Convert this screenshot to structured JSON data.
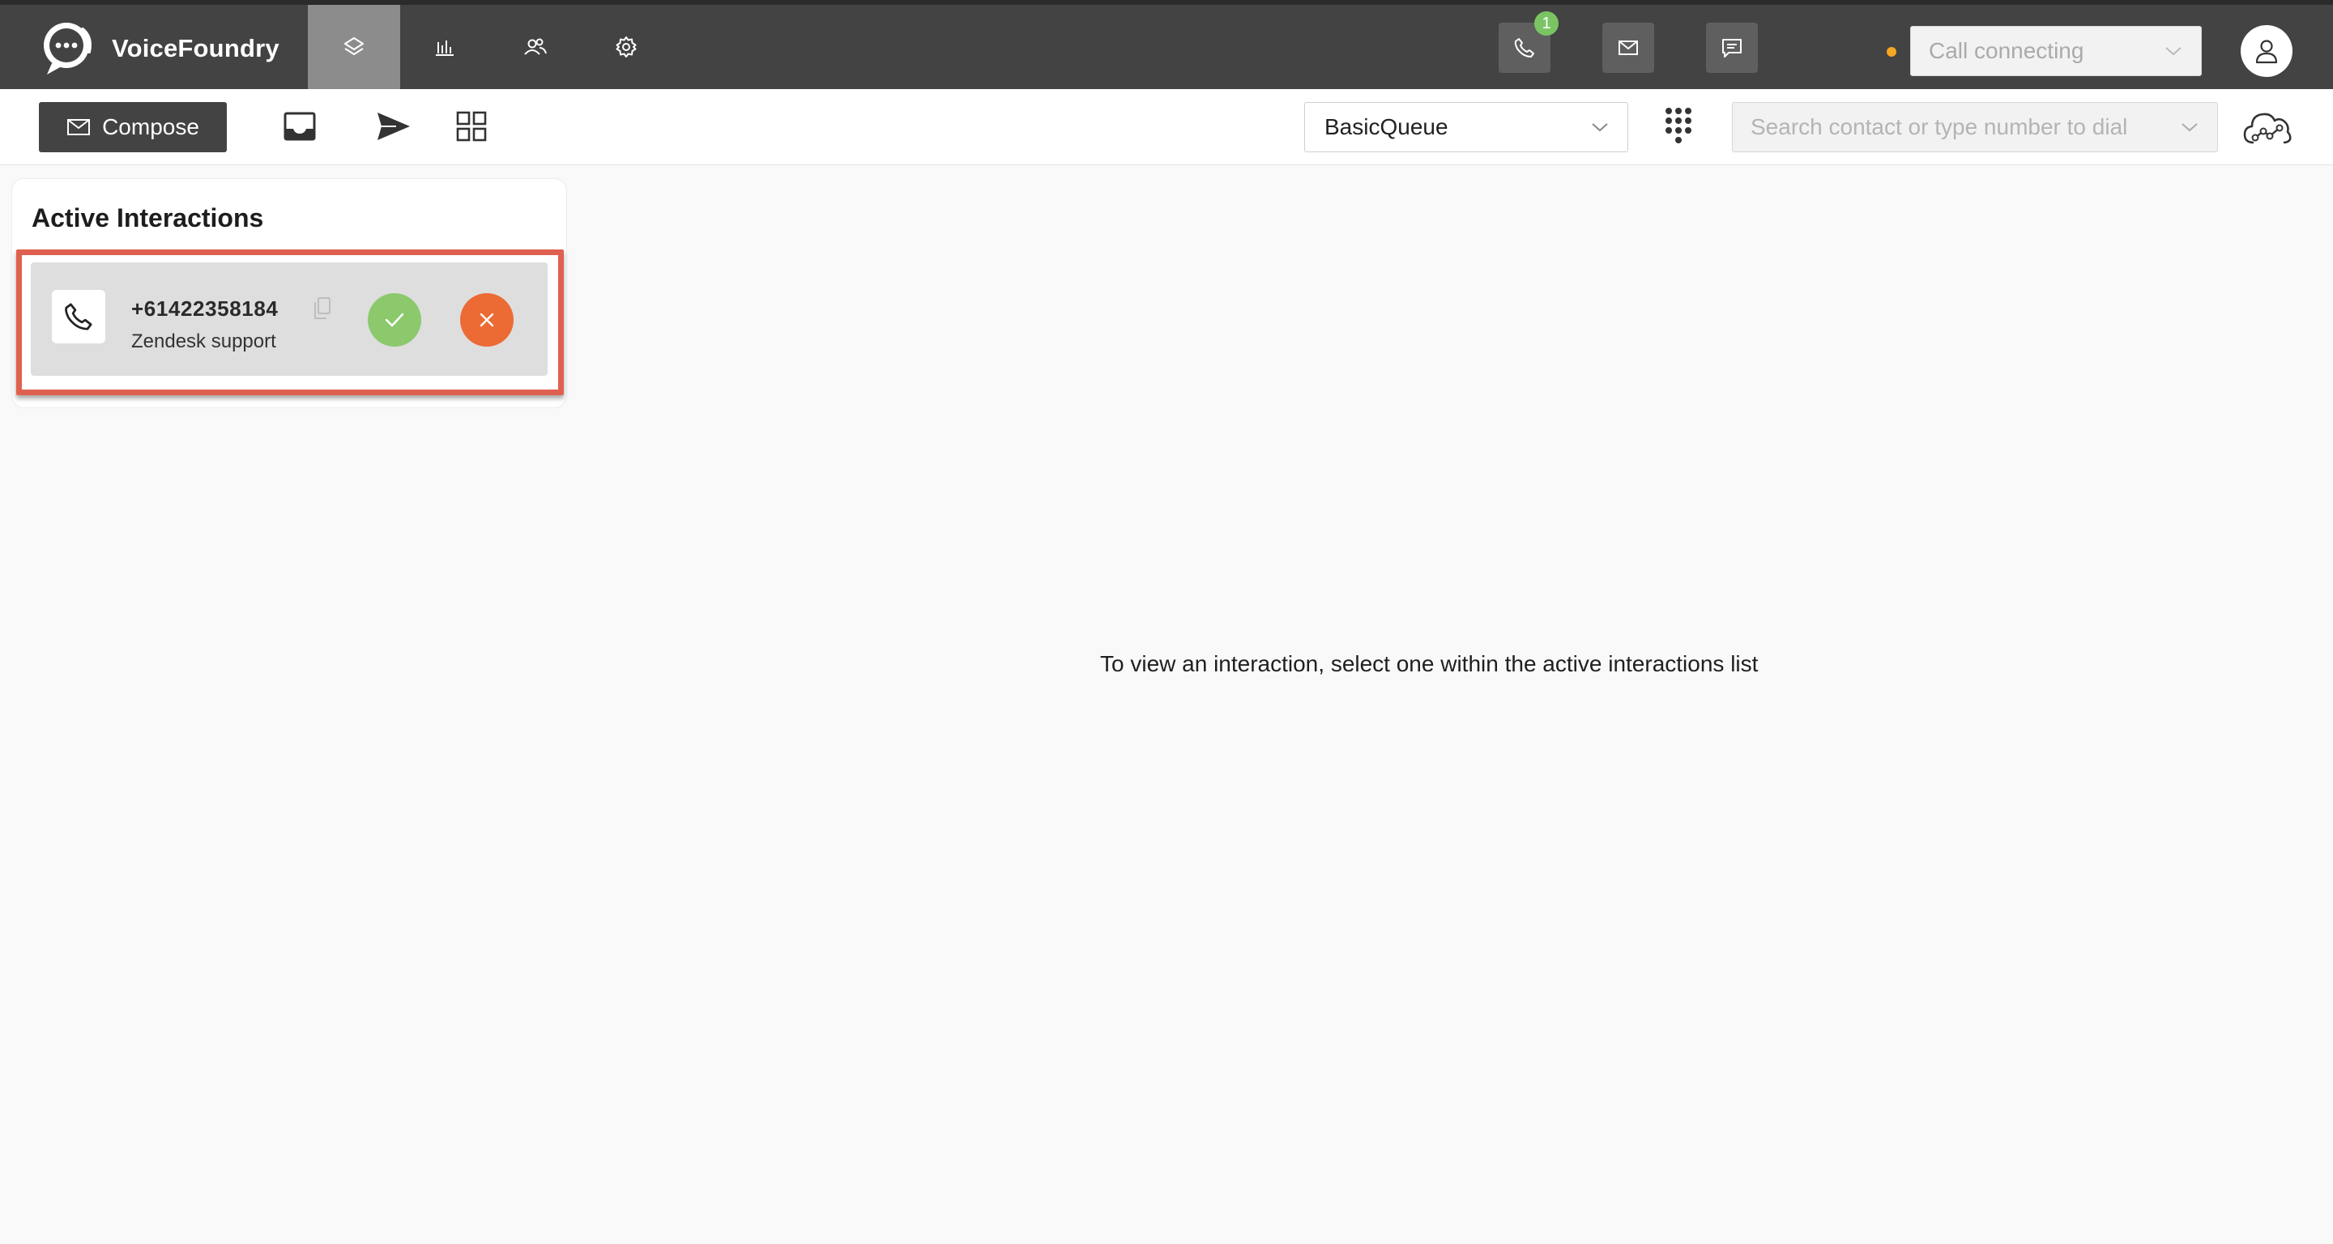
{
  "app": {
    "name": "VoiceFoundry"
  },
  "nav": {
    "tabs": [
      {
        "icon": "layers-icon"
      },
      {
        "icon": "bar-chart-icon"
      },
      {
        "icon": "users-icon"
      },
      {
        "icon": "gear-icon"
      }
    ],
    "channels": {
      "phone": {
        "icon": "phone-icon",
        "badge": "1"
      },
      "email": {
        "icon": "envelope-icon"
      },
      "chat": {
        "icon": "chat-icon"
      }
    },
    "status": {
      "value": "Call connecting",
      "dot_color": "#f5a623"
    },
    "profile": {
      "icon": "user-icon"
    }
  },
  "toolbar": {
    "compose_label": "Compose",
    "queue_value": "BasicQueue",
    "search_placeholder": "Search contact or type number to dial"
  },
  "panel": {
    "title": "Active Interactions",
    "interactions": [
      {
        "number": "+61422358184",
        "queue": "Zendesk support",
        "channel_icon": "phone-icon"
      }
    ]
  },
  "main": {
    "empty_message": "To view an interaction, select one within the active interactions list"
  },
  "colors": {
    "topbar": "#434343",
    "accept": "#8cc96d",
    "reject": "#ec6a34",
    "highlight": "#e0604f",
    "badge": "#7bc463"
  }
}
